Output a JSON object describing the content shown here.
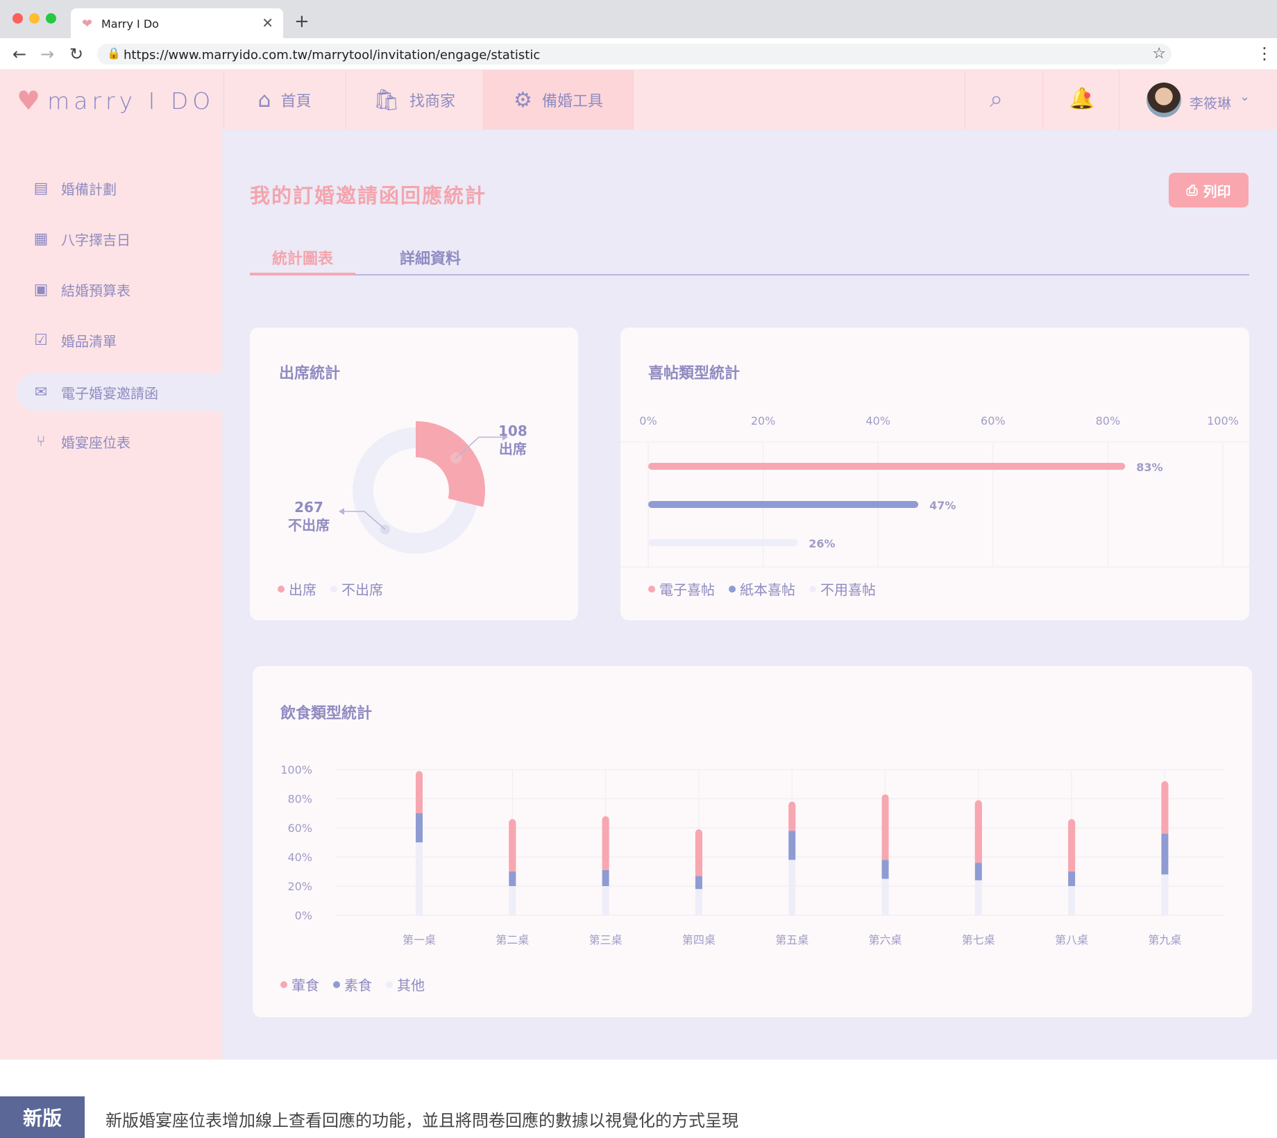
{
  "browser": {
    "tab_title": "Marry I Do",
    "url": "https://www.marryido.com.tw/marrytool/invitation/engage/statistic",
    "new_tab": "+",
    "close": "✕"
  },
  "header": {
    "logo_text": "marry I DO",
    "nav": [
      {
        "label": "首頁",
        "icon": "home-icon"
      },
      {
        "label": "找商家",
        "icon": "shop-icon"
      },
      {
        "label": "備婚工具",
        "icon": "gear-icon",
        "active": true
      }
    ],
    "user_name": "李筱琳"
  },
  "sidebar": {
    "items": [
      {
        "label": "婚備計劃",
        "icon": "plan-icon"
      },
      {
        "label": "八字擇吉日",
        "icon": "calendar-icon"
      },
      {
        "label": "結婚預算表",
        "icon": "budget-icon"
      },
      {
        "label": "婚品清單",
        "icon": "checklist-icon"
      },
      {
        "label": "電子婚宴邀請函",
        "icon": "invitation-icon",
        "active": true
      },
      {
        "label": "婚宴座位表",
        "icon": "seat-icon"
      }
    ]
  },
  "page": {
    "title": "我的訂婚邀請函回應統計",
    "print_label": "列印",
    "tabs": [
      {
        "label": "統計圖表",
        "active": true
      },
      {
        "label": "詳細資料",
        "active": false
      }
    ]
  },
  "attendance": {
    "title": "出席統計",
    "attend_count": "108",
    "attend_label": "出席",
    "absent_count": "267",
    "absent_label": "不出席",
    "legend": [
      "出席",
      "不出席"
    ]
  },
  "invite_type": {
    "title": "喜帖類型統計",
    "legend": [
      "電子喜帖",
      "紙本喜帖",
      "不用喜帖"
    ]
  },
  "diet": {
    "title": "飲食類型統計",
    "legend": [
      "葷食",
      "素食",
      "其他"
    ]
  },
  "colors": {
    "pink": "#f7a7b0",
    "purple": "#8f9bd3",
    "light": "#eeeef8",
    "text": "#8f8bc2"
  },
  "footer": {
    "tag": "新版",
    "text": "新版婚宴座位表增加線上查看回應的功能，並且將問卷回應的數據以視覺化的方式呈現"
  },
  "chart_data": [
    {
      "type": "pie",
      "title": "出席統計",
      "labels": [
        "出席",
        "不出席"
      ],
      "values": [
        108,
        267
      ]
    },
    {
      "type": "bar",
      "title": "喜帖類型統計",
      "orientation": "horizontal",
      "categories": [
        "電子喜帖",
        "紙本喜帖",
        "不用喜帖"
      ],
      "values": [
        83,
        47,
        26
      ],
      "value_labels": [
        "83%",
        "47%",
        "26%"
      ],
      "x_ticks": [
        "0%",
        "20%",
        "40%",
        "60%",
        "80%",
        "100%"
      ],
      "xlim": [
        0,
        100
      ]
    },
    {
      "type": "bar",
      "title": "飲食類型統計",
      "stacked": true,
      "categories": [
        "第一桌",
        "第二桌",
        "第三桌",
        "第四桌",
        "第五桌",
        "第六桌",
        "第七桌",
        "第八桌",
        "第九桌"
      ],
      "series": [
        {
          "name": "其他",
          "values": [
            50,
            20,
            20,
            18,
            38,
            25,
            24,
            20,
            28
          ]
        },
        {
          "name": "素食",
          "values": [
            20,
            10,
            11,
            9,
            20,
            13,
            12,
            10,
            28
          ]
        },
        {
          "name": "葷食",
          "values": [
            29,
            36,
            37,
            32,
            20,
            45,
            43,
            36,
            36
          ]
        }
      ],
      "y_ticks": [
        "0%",
        "20%",
        "40%",
        "60%",
        "80%",
        "100%"
      ],
      "ylim": [
        0,
        100
      ]
    }
  ]
}
